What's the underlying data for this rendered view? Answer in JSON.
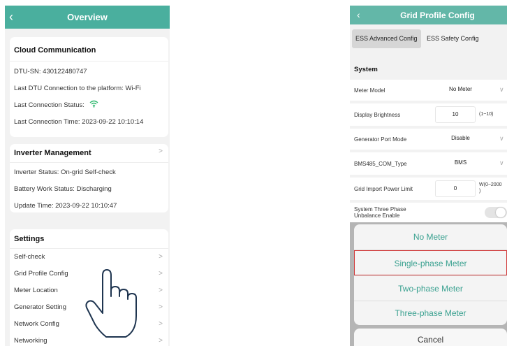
{
  "left_screen": {
    "header": {
      "back_icon": "chevron-left-icon",
      "title": "Overview"
    },
    "cloud": {
      "title": "Cloud Communication",
      "dtu_sn": "DTU-SN:  430122480747",
      "last_connection": "Last DTU Connection to the platform:  Wi-Fi",
      "status_label": "Last Connection Status:",
      "status_icon": "wifi-icon",
      "last_time": "Last Connection Time:  2023-09-22 10:10:14"
    },
    "inverter": {
      "title": "Inverter Management",
      "status": "Inverter Status:  On-grid Self-check",
      "battery": "Battery Work Status:  Discharging",
      "update": "Update Time:  2023-09-22 10:10:47"
    },
    "settings": {
      "title": "Settings",
      "items": [
        {
          "label": "Self-check"
        },
        {
          "label": "Grid Profile Config"
        },
        {
          "label": "Meter Location"
        },
        {
          "label": "Generator Setting"
        },
        {
          "label": "Network Config"
        },
        {
          "label": "Networking"
        }
      ]
    },
    "accent_color": "#4aaf9e"
  },
  "right_screen": {
    "header": {
      "back_icon": "chevron-left-icon",
      "title": "Grid Profile Config"
    },
    "tabs": [
      {
        "label": "ESS Advanced Config",
        "active": true
      },
      {
        "label": "ESS Safety Config",
        "active": false
      }
    ],
    "section": "System",
    "rows": [
      {
        "label": "Meter Model",
        "value": "No Meter",
        "unit": ""
      },
      {
        "label": "Display Brightness",
        "value": "10",
        "unit": "(1~10)"
      },
      {
        "label": "Generator Port Mode",
        "value": "Disable",
        "unit": ""
      },
      {
        "label": "BMS485_COM_Type",
        "value": "BMS",
        "unit": ""
      },
      {
        "label": "Grid Import Power Limit",
        "value": "0",
        "unit": "W(0~2000\n)"
      },
      {
        "label": "System Three Phase\nUnbalance Enable",
        "value": "",
        "unit": ""
      }
    ],
    "picker": {
      "options": [
        "No Meter",
        "Single-phase Meter",
        "Two-phase Meter",
        "Three-phase Meter"
      ],
      "selected_index": 1,
      "cancel": "Cancel"
    }
  }
}
